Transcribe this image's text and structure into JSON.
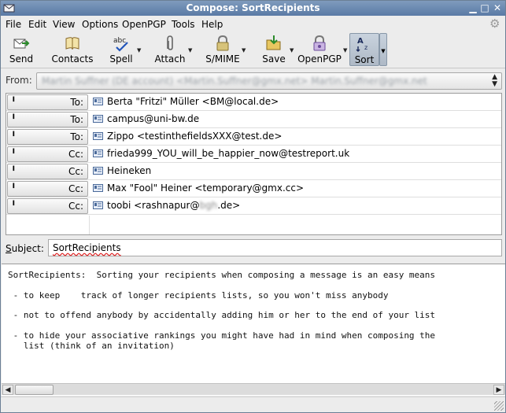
{
  "window": {
    "title": "Compose: SortRecipients"
  },
  "menu": [
    "File",
    "Edit",
    "View",
    "Options",
    "OpenPGP",
    "Tools",
    "Help"
  ],
  "toolbar": {
    "send": "Send",
    "contacts": "Contacts",
    "spell": "Spell",
    "attach": "Attach",
    "smime": "S/MIME",
    "save": "Save",
    "openpgp": "OpenPGP",
    "sort": "Sort"
  },
  "from": {
    "label": "From:",
    "value": "Martin Suffner (DE account) <Martin.Suffner@gmx.net>        Martin.Suffner@gmx.net"
  },
  "recipients": [
    {
      "type": "To:",
      "address": "Berta \"Fritzi\" Müller <BM@local.de>"
    },
    {
      "type": "To:",
      "address": "campus@uni-bw.de"
    },
    {
      "type": "To:",
      "address": "Zippo <testinthefieldsXXX@test.de>"
    },
    {
      "type": "Cc:",
      "address": "frieda999_YOU_will_be_happier_now@testreport.uk"
    },
    {
      "type": "Cc:",
      "address": "Heineken"
    },
    {
      "type": "Cc:",
      "address": "Max \"Fool\" Heiner <temporary@gmx.cc>"
    },
    {
      "type": "Cc:",
      "address_pre": "toobi <rashnapur@",
      "address_blur": "bgh",
      "address_post": ".de>"
    }
  ],
  "subject": {
    "label": "Subject:",
    "value": "SortRecipients"
  },
  "body": "SortRecipients:  Sorting your recipients when composing a message is an easy means\n\n - to keep    track of longer recipients lists, so you won't miss anybody\n\n - not to offend anybody by accidentally adding him or her to the end of your list\n\n - to hide your associative rankings you might have had in mind when composing the\n   list (think of an invitation)"
}
